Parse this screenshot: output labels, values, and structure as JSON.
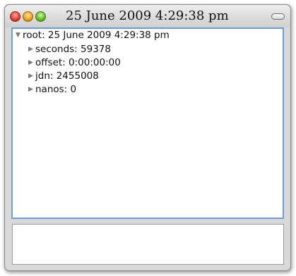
{
  "window": {
    "title": "25 June 2009 4:29:38 pm"
  },
  "tree": {
    "root": {
      "label": "root: 25 June 2009 4:29:38 pm",
      "expanded": true,
      "children": [
        {
          "label": "seconds: 59378",
          "expanded": false
        },
        {
          "label": "offset: 0:00:00:00",
          "expanded": false
        },
        {
          "label": "jdn: 2455008",
          "expanded": false
        },
        {
          "label": "nanos: 0",
          "expanded": false
        }
      ]
    }
  },
  "glyphs": {
    "expanded": "▼",
    "collapsed": "▶"
  }
}
